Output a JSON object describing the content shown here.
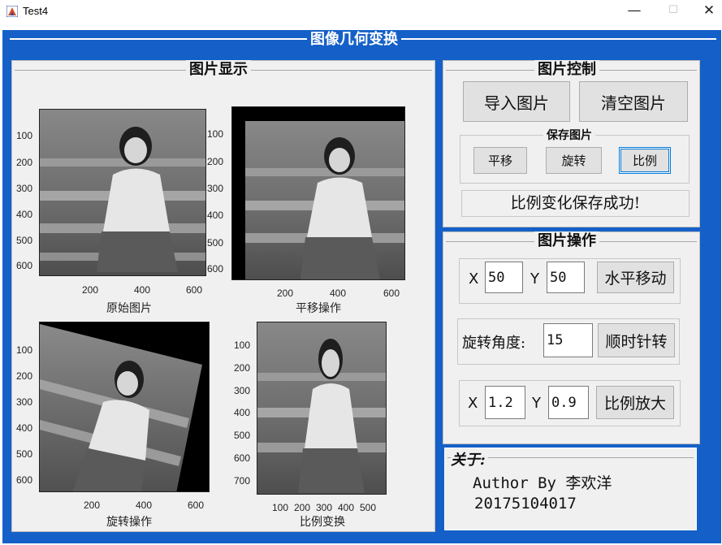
{
  "window": {
    "title": "Test4",
    "minimize_glyph": "—",
    "maximize_glyph": "☐",
    "close_glyph": "✕",
    "icon": "matlab-figure-icon"
  },
  "frame": {
    "title": "图像几何变换"
  },
  "display_panel": {
    "title": "图片显示",
    "axes": [
      {
        "xlabel": "原始图片",
        "yticks": [
          "100",
          "200",
          "300",
          "400",
          "500",
          "600"
        ],
        "xticks": [
          "200",
          "400",
          "600"
        ]
      },
      {
        "xlabel": "平移操作",
        "yticks": [
          "100",
          "200",
          "300",
          "400",
          "500",
          "600"
        ],
        "xticks": [
          "200",
          "400",
          "600"
        ]
      },
      {
        "xlabel": "旋转操作",
        "yticks": [
          "100",
          "200",
          "300",
          "400",
          "500",
          "600"
        ],
        "xticks": [
          "200",
          "400",
          "600"
        ]
      },
      {
        "xlabel": "比例变换",
        "yticks": [
          "100",
          "200",
          "300",
          "400",
          "500",
          "600",
          "700"
        ],
        "xticks": [
          "100",
          "200",
          "300",
          "400",
          "500"
        ]
      }
    ]
  },
  "control_panel": {
    "title": "图片控制",
    "import_label": "导入图片",
    "clear_label": "清空图片",
    "save_group": {
      "title": "保存图片",
      "translate_label": "平移",
      "rotate_label": "旋转",
      "scale_label": "比例"
    },
    "status": "比例变化保存成功!"
  },
  "operation_panel": {
    "title": "图片操作",
    "translate": {
      "x_label": "X",
      "x_value": "50",
      "y_label": "Y",
      "y_value": "50",
      "button_label": "水平移动"
    },
    "rotate": {
      "label": "旋转角度:",
      "value": "15",
      "button_label": "顺时针转"
    },
    "scale": {
      "x_label": "X",
      "x_value": "1.2",
      "y_label": "Y",
      "y_value": "0.9",
      "button_label": "比例放大"
    }
  },
  "about_panel": {
    "title": "关于:",
    "author": "Author By 李欢洋",
    "id": "20175104017"
  },
  "colors": {
    "frame_blue": "#1560c8",
    "panel_bg": "#f0f0f0",
    "button_bg": "#e1e1e1",
    "focus_blue": "#0078d7"
  }
}
